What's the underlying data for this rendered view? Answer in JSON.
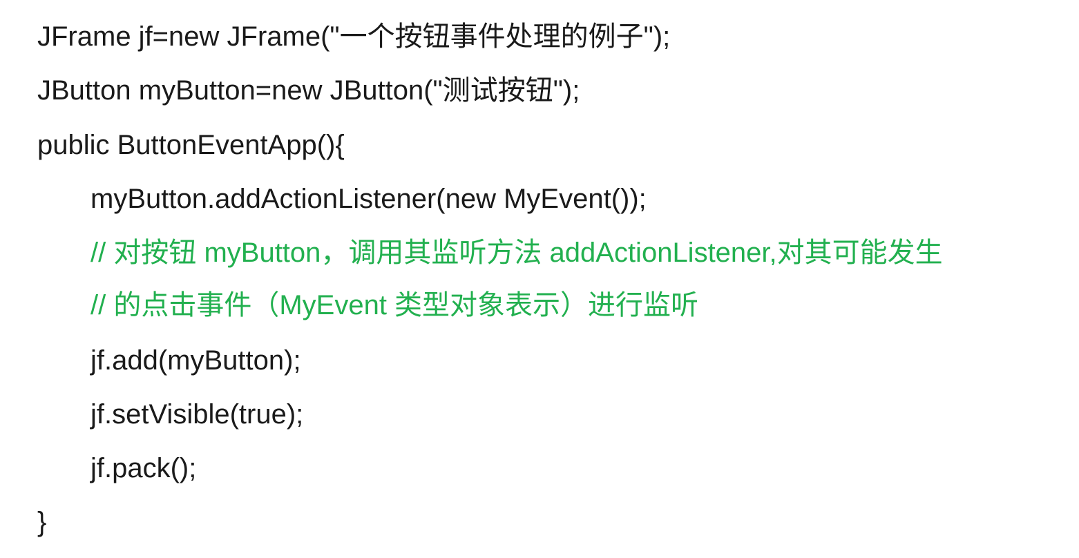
{
  "code": {
    "lines": [
      {
        "text": "JFrame jf=new JFrame(\"一个按钮事件处理的例子\");",
        "kind": "code"
      },
      {
        "text": "JButton myButton=new JButton(\"测试按钮\");",
        "kind": "code"
      },
      {
        "text": "public ButtonEventApp(){",
        "kind": "code"
      },
      {
        "text": "myButton.addActionListener(new MyEvent());",
        "kind": "code"
      },
      {
        "text": "// 对按钮 myButton，调用其监听方法 addActionListener,对其可能发生",
        "kind": "comment"
      },
      {
        "text": "// 的点击事件（MyEvent 类型对象表示）进行监听",
        "kind": "comment"
      },
      {
        "text": "jf.add(myButton);",
        "kind": "code"
      },
      {
        "text": "jf.setVisible(true);",
        "kind": "code"
      },
      {
        "text": "jf.pack();",
        "kind": "code"
      },
      {
        "text": "}",
        "kind": "code"
      }
    ]
  },
  "colors": {
    "code": "#1a1a1a",
    "comment": "#22b04f",
    "background": "#ffffff"
  }
}
